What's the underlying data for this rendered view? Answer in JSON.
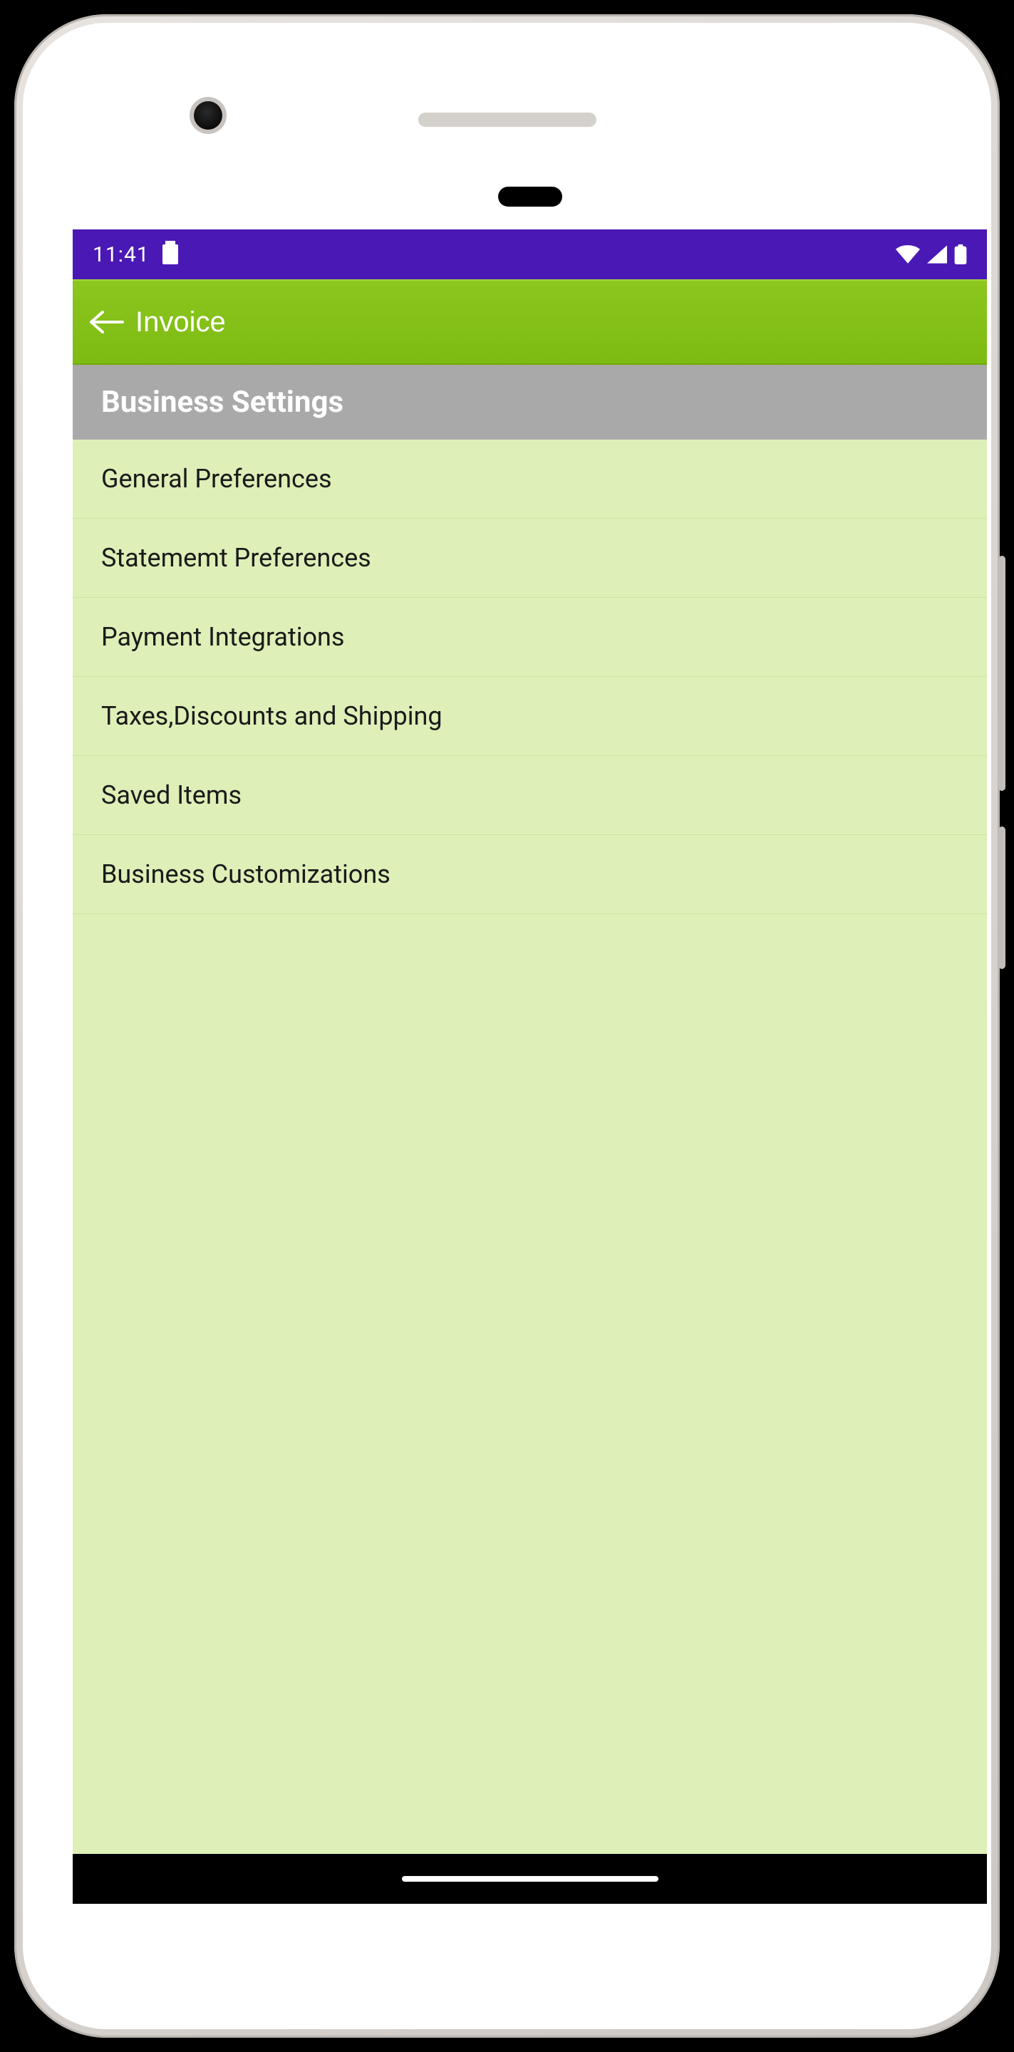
{
  "status_bar": {
    "time": "11:41",
    "icons": {
      "sd": "sd-card-icon",
      "wifi": "wifi-icon",
      "signal": "cell-signal-icon",
      "battery": "battery-icon"
    }
  },
  "app_bar": {
    "title": "Invoice",
    "back_icon": "back-arrow-icon"
  },
  "section": {
    "title": "Business Settings"
  },
  "settings": {
    "items": [
      {
        "label": "General Preferences"
      },
      {
        "label": "Statememt Preferences"
      },
      {
        "label": "Payment Integrations"
      },
      {
        "label": "Taxes,Discounts and Shipping"
      },
      {
        "label": "Saved Items"
      },
      {
        "label": "Business Customizations"
      }
    ]
  },
  "colors": {
    "status_bar_bg": "#4a18b5",
    "app_bar_bg": "#7dbb12",
    "section_header_bg": "#a9a9a9",
    "list_bg": "#deefb7"
  }
}
